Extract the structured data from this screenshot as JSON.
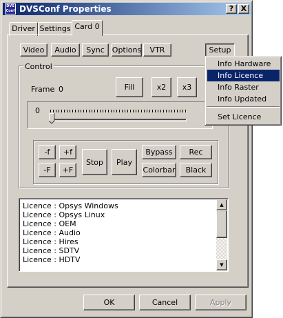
{
  "window": {
    "title": "DVSConf Properties",
    "icon_name": "dvsconf-app-icon",
    "icon_text": "DVS\nConf",
    "help_btn": "?",
    "close_btn": "X"
  },
  "tabs": [
    {
      "label": "Driver",
      "active": false
    },
    {
      "label": "Settings",
      "active": false
    },
    {
      "label": "Card 0",
      "active": true
    }
  ],
  "subtabs": [
    "Video",
    "Audio",
    "Sync",
    "Options",
    "VTR"
  ],
  "setup_label": "Setup",
  "control": {
    "group_label": "Control",
    "frame_label": "Frame",
    "frame_value": "0",
    "fill_label": "Fill",
    "x2_label": "x2",
    "x3_label": "x3",
    "slider_value": "0"
  },
  "transport": {
    "minus_f": "-f",
    "plus_f": "+f",
    "minus_F": "-F",
    "plus_F": "+F",
    "stop": "Stop",
    "play": "Play",
    "bypass": "Bypass",
    "rec": "Rec",
    "colorbar": "Colorbar",
    "black": "Black"
  },
  "list": {
    "items": [
      "Licence : Opsys Windows",
      "Licence : Opsys Linux",
      "Licence : OEM",
      "Licence : Audio",
      "Licence : Hires",
      "Licence : SDTV",
      "Licence : HDTV"
    ]
  },
  "footer": {
    "ok": "OK",
    "cancel": "Cancel",
    "apply": "Apply"
  },
  "setup_menu": {
    "items": [
      "Info Hardware",
      "Info Licence",
      "Info Raster",
      "Info Updated",
      "Set Licence"
    ],
    "highlighted": "Info Licence"
  },
  "colors": {
    "titlebar_start": "#0a246a",
    "titlebar_end": "#a6caf0",
    "face": "#d4d0c8",
    "highlight": "#0a246a"
  }
}
